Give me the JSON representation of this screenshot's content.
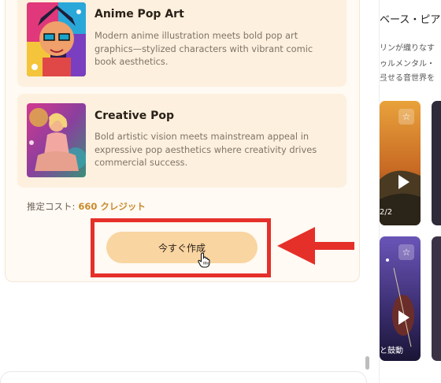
{
  "styles": [
    {
      "title": "Anime Pop Art",
      "desc": "Modern anime illustration meets bold pop art graphics—stylized characters with vibrant comic book aesthetics."
    },
    {
      "title": "Creative Pop",
      "desc": "Bold artistic vision meets mainstream appeal in expressive pop aesthetics where creativity drives commercial success."
    }
  ],
  "cost": {
    "label": "推定コスト:",
    "value": "660 クレジット"
  },
  "create_button": {
    "label": "今すぐ作成"
  },
  "right": {
    "title": "ベース・ピア",
    "lines": [
      "リンが織りなす",
      "ゥルメンタル・",
      "弖せる音世界を"
    ],
    "thumb_captions": [
      "2/2",
      "と鼓動"
    ]
  },
  "colors": {
    "accent": "#f9d5a2",
    "highlight": "#e5302a",
    "cost_value": "#c98a2e"
  },
  "icons": [
    "star-icon",
    "play-icon",
    "hand-cursor-icon",
    "red-arrow-icon"
  ]
}
